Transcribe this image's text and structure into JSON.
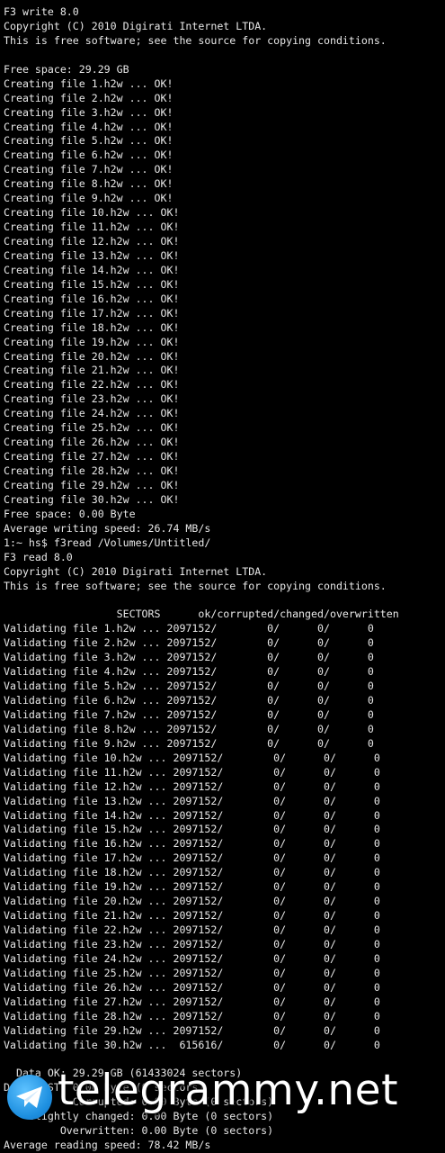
{
  "terminal_lines": [
    "F3 write 8.0",
    "Copyright (C) 2010 Digirati Internet LTDA.",
    "This is free software; see the source for copying conditions.",
    "",
    "Free space: 29.29 GB",
    "Creating file 1.h2w ... OK!",
    "Creating file 2.h2w ... OK!",
    "Creating file 3.h2w ... OK!",
    "Creating file 4.h2w ... OK!",
    "Creating file 5.h2w ... OK!",
    "Creating file 6.h2w ... OK!",
    "Creating file 7.h2w ... OK!",
    "Creating file 8.h2w ... OK!",
    "Creating file 9.h2w ... OK!",
    "Creating file 10.h2w ... OK!",
    "Creating file 11.h2w ... OK!",
    "Creating file 12.h2w ... OK!",
    "Creating file 13.h2w ... OK!",
    "Creating file 14.h2w ... OK!",
    "Creating file 15.h2w ... OK!",
    "Creating file 16.h2w ... OK!",
    "Creating file 17.h2w ... OK!",
    "Creating file 18.h2w ... OK!",
    "Creating file 19.h2w ... OK!",
    "Creating file 20.h2w ... OK!",
    "Creating file 21.h2w ... OK!",
    "Creating file 22.h2w ... OK!",
    "Creating file 23.h2w ... OK!",
    "Creating file 24.h2w ... OK!",
    "Creating file 25.h2w ... OK!",
    "Creating file 26.h2w ... OK!",
    "Creating file 27.h2w ... OK!",
    "Creating file 28.h2w ... OK!",
    "Creating file 29.h2w ... OK!",
    "Creating file 30.h2w ... OK!",
    "Free space: 0.00 Byte",
    "Average writing speed: 26.74 MB/s",
    "1:~ hs$ f3read /Volumes/Untitled/",
    "F3 read 8.0",
    "Copyright (C) 2010 Digirati Internet LTDA.",
    "This is free software; see the source for copying conditions.",
    "",
    "                  SECTORS      ok/corrupted/changed/overwritten",
    "Validating file 1.h2w ... 2097152/        0/      0/      0",
    "Validating file 2.h2w ... 2097152/        0/      0/      0",
    "Validating file 3.h2w ... 2097152/        0/      0/      0",
    "Validating file 4.h2w ... 2097152/        0/      0/      0",
    "Validating file 5.h2w ... 2097152/        0/      0/      0",
    "Validating file 6.h2w ... 2097152/        0/      0/      0",
    "Validating file 7.h2w ... 2097152/        0/      0/      0",
    "Validating file 8.h2w ... 2097152/        0/      0/      0",
    "Validating file 9.h2w ... 2097152/        0/      0/      0",
    "Validating file 10.h2w ... 2097152/        0/      0/      0",
    "Validating file 11.h2w ... 2097152/        0/      0/      0",
    "Validating file 12.h2w ... 2097152/        0/      0/      0",
    "Validating file 13.h2w ... 2097152/        0/      0/      0",
    "Validating file 14.h2w ... 2097152/        0/      0/      0",
    "Validating file 15.h2w ... 2097152/        0/      0/      0",
    "Validating file 16.h2w ... 2097152/        0/      0/      0",
    "Validating file 17.h2w ... 2097152/        0/      0/      0",
    "Validating file 18.h2w ... 2097152/        0/      0/      0",
    "Validating file 19.h2w ... 2097152/        0/      0/      0",
    "Validating file 20.h2w ... 2097152/        0/      0/      0",
    "Validating file 21.h2w ... 2097152/        0/      0/      0",
    "Validating file 22.h2w ... 2097152/        0/      0/      0",
    "Validating file 23.h2w ... 2097152/        0/      0/      0",
    "Validating file 24.h2w ... 2097152/        0/      0/      0",
    "Validating file 25.h2w ... 2097152/        0/      0/      0",
    "Validating file 26.h2w ... 2097152/        0/      0/      0",
    "Validating file 27.h2w ... 2097152/        0/      0/      0",
    "Validating file 28.h2w ... 2097152/        0/      0/      0",
    "Validating file 29.h2w ... 2097152/        0/      0/      0",
    "Validating file 30.h2w ...  615616/        0/      0/      0",
    "",
    "  Data OK: 29.29 GB (61433024 sectors)",
    "Data LOST: 0.00 Byte (0 sectors)",
    "           Corrupted: 0.00 Byte (0 sectors)",
    "    Slightly changed: 0.00 Byte (0 sectors)",
    "         Overwritten: 0.00 Byte (0 sectors)",
    "Average reading speed: 78.42 MB/s"
  ],
  "watermark": {
    "text": "telegrammy.net",
    "icon": "telegram-paper-plane-icon",
    "color_brand": "#2aa3ef"
  },
  "colors": {
    "background": "#000000",
    "text": "#e8e8e8"
  }
}
